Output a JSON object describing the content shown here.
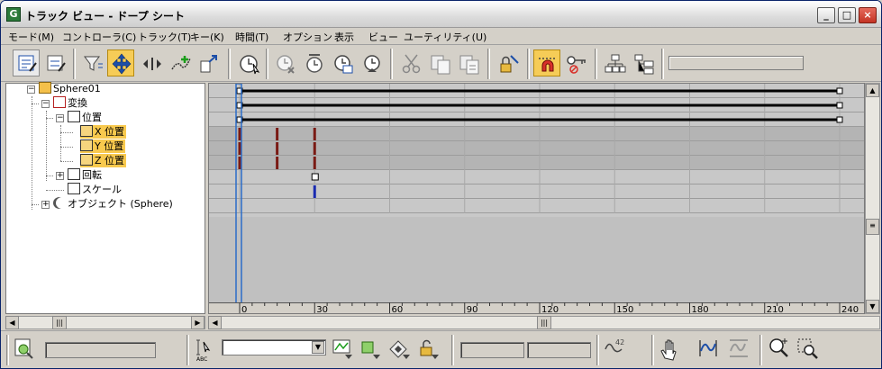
{
  "window": {
    "title": "トラック ビュー - ドープ シート",
    "icon_letter": "G"
  },
  "window_buttons": {
    "minimize": "_",
    "maximize": "□",
    "close": "×"
  },
  "menu": [
    "モード(M)",
    "コントローラ(C)",
    "トラック(T)",
    "キー(K)",
    "時間(T)",
    "オプション",
    "表示",
    "ビュー",
    "ユーティリティ(U)"
  ],
  "tree": {
    "nodes": [
      {
        "label": "Sphere01",
        "icon": "sphere-object-icon",
        "selected": false
      },
      {
        "label": "変換",
        "icon": "transform-icon",
        "selected": false
      },
      {
        "label": "位置",
        "icon": "position-icon",
        "selected": false
      },
      {
        "label": "X 位置",
        "icon": "float-track-icon",
        "selected": true
      },
      {
        "label": "Y 位置",
        "icon": "float-track-icon",
        "selected": true
      },
      {
        "label": "Z 位置",
        "icon": "float-track-icon",
        "selected": true
      },
      {
        "label": "回転",
        "icon": "rotation-icon",
        "selected": false
      },
      {
        "label": "スケール",
        "icon": "scale-icon",
        "selected": false
      },
      {
        "label": "オブジェクト (Sphere)",
        "icon": "object-icon",
        "selected": false
      }
    ]
  },
  "timeline": {
    "ticks": [
      "0",
      "30",
      "60",
      "90",
      "120",
      "150",
      "180",
      "210",
      "240"
    ],
    "start": 0,
    "end": 240,
    "current_frame": 0,
    "keys": [
      {
        "row": 3,
        "frame": 0,
        "color": "#7a1a14"
      },
      {
        "row": 3,
        "frame": 15,
        "color": "#7a1a14"
      },
      {
        "row": 3,
        "frame": 30,
        "color": "#7a1a14"
      },
      {
        "row": 6,
        "frame": 30,
        "color": "#ffffff"
      },
      {
        "row": 7,
        "frame": 30,
        "color": "#1a2bb0"
      }
    ],
    "range_rows": [
      0,
      1,
      2
    ]
  },
  "bottom": {
    "dropdown_value": ""
  },
  "colors": {
    "selection": "#f8c94e",
    "active_tool": "#f6cc57",
    "current_time_line": "#2a6cc8"
  }
}
